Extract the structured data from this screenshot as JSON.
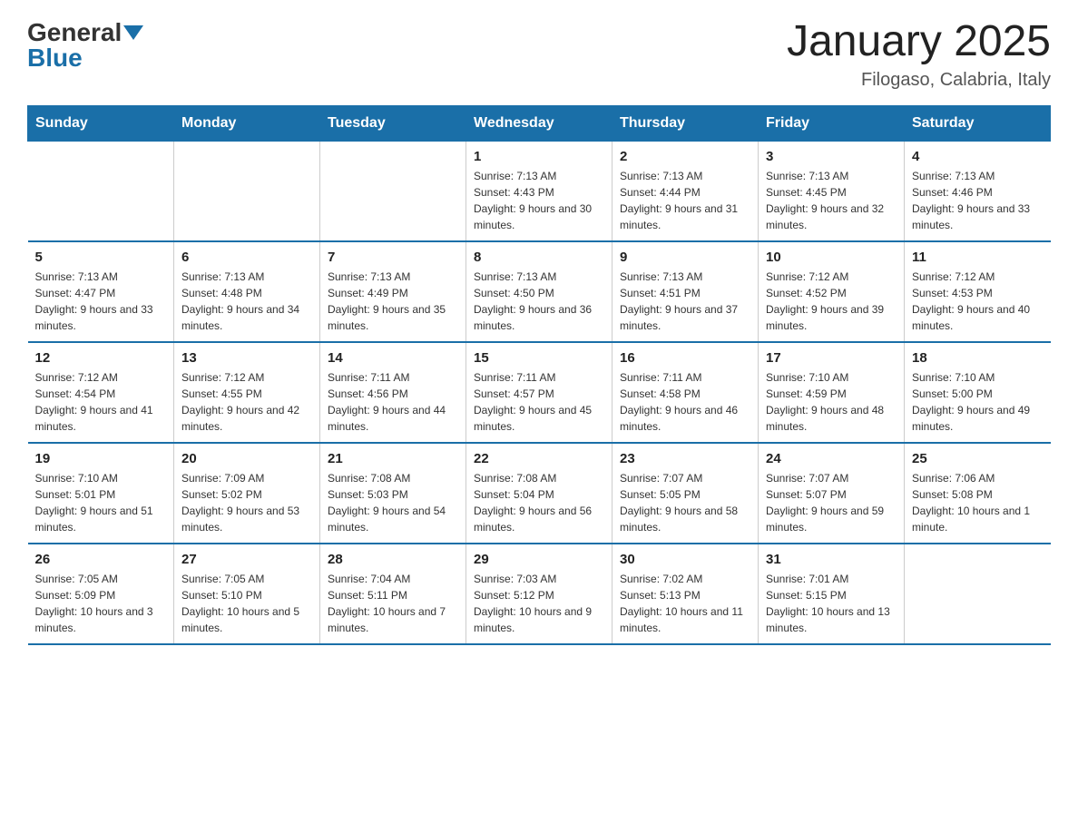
{
  "logo": {
    "general": "General",
    "blue": "Blue"
  },
  "title": "January 2025",
  "subtitle": "Filogaso, Calabria, Italy",
  "days_of_week": [
    "Sunday",
    "Monday",
    "Tuesday",
    "Wednesday",
    "Thursday",
    "Friday",
    "Saturday"
  ],
  "weeks": [
    [
      {
        "day": "",
        "info": ""
      },
      {
        "day": "",
        "info": ""
      },
      {
        "day": "",
        "info": ""
      },
      {
        "day": "1",
        "info": "Sunrise: 7:13 AM\nSunset: 4:43 PM\nDaylight: 9 hours and 30 minutes."
      },
      {
        "day": "2",
        "info": "Sunrise: 7:13 AM\nSunset: 4:44 PM\nDaylight: 9 hours and 31 minutes."
      },
      {
        "day": "3",
        "info": "Sunrise: 7:13 AM\nSunset: 4:45 PM\nDaylight: 9 hours and 32 minutes."
      },
      {
        "day": "4",
        "info": "Sunrise: 7:13 AM\nSunset: 4:46 PM\nDaylight: 9 hours and 33 minutes."
      }
    ],
    [
      {
        "day": "5",
        "info": "Sunrise: 7:13 AM\nSunset: 4:47 PM\nDaylight: 9 hours and 33 minutes."
      },
      {
        "day": "6",
        "info": "Sunrise: 7:13 AM\nSunset: 4:48 PM\nDaylight: 9 hours and 34 minutes."
      },
      {
        "day": "7",
        "info": "Sunrise: 7:13 AM\nSunset: 4:49 PM\nDaylight: 9 hours and 35 minutes."
      },
      {
        "day": "8",
        "info": "Sunrise: 7:13 AM\nSunset: 4:50 PM\nDaylight: 9 hours and 36 minutes."
      },
      {
        "day": "9",
        "info": "Sunrise: 7:13 AM\nSunset: 4:51 PM\nDaylight: 9 hours and 37 minutes."
      },
      {
        "day": "10",
        "info": "Sunrise: 7:12 AM\nSunset: 4:52 PM\nDaylight: 9 hours and 39 minutes."
      },
      {
        "day": "11",
        "info": "Sunrise: 7:12 AM\nSunset: 4:53 PM\nDaylight: 9 hours and 40 minutes."
      }
    ],
    [
      {
        "day": "12",
        "info": "Sunrise: 7:12 AM\nSunset: 4:54 PM\nDaylight: 9 hours and 41 minutes."
      },
      {
        "day": "13",
        "info": "Sunrise: 7:12 AM\nSunset: 4:55 PM\nDaylight: 9 hours and 42 minutes."
      },
      {
        "day": "14",
        "info": "Sunrise: 7:11 AM\nSunset: 4:56 PM\nDaylight: 9 hours and 44 minutes."
      },
      {
        "day": "15",
        "info": "Sunrise: 7:11 AM\nSunset: 4:57 PM\nDaylight: 9 hours and 45 minutes."
      },
      {
        "day": "16",
        "info": "Sunrise: 7:11 AM\nSunset: 4:58 PM\nDaylight: 9 hours and 46 minutes."
      },
      {
        "day": "17",
        "info": "Sunrise: 7:10 AM\nSunset: 4:59 PM\nDaylight: 9 hours and 48 minutes."
      },
      {
        "day": "18",
        "info": "Sunrise: 7:10 AM\nSunset: 5:00 PM\nDaylight: 9 hours and 49 minutes."
      }
    ],
    [
      {
        "day": "19",
        "info": "Sunrise: 7:10 AM\nSunset: 5:01 PM\nDaylight: 9 hours and 51 minutes."
      },
      {
        "day": "20",
        "info": "Sunrise: 7:09 AM\nSunset: 5:02 PM\nDaylight: 9 hours and 53 minutes."
      },
      {
        "day": "21",
        "info": "Sunrise: 7:08 AM\nSunset: 5:03 PM\nDaylight: 9 hours and 54 minutes."
      },
      {
        "day": "22",
        "info": "Sunrise: 7:08 AM\nSunset: 5:04 PM\nDaylight: 9 hours and 56 minutes."
      },
      {
        "day": "23",
        "info": "Sunrise: 7:07 AM\nSunset: 5:05 PM\nDaylight: 9 hours and 58 minutes."
      },
      {
        "day": "24",
        "info": "Sunrise: 7:07 AM\nSunset: 5:07 PM\nDaylight: 9 hours and 59 minutes."
      },
      {
        "day": "25",
        "info": "Sunrise: 7:06 AM\nSunset: 5:08 PM\nDaylight: 10 hours and 1 minute."
      }
    ],
    [
      {
        "day": "26",
        "info": "Sunrise: 7:05 AM\nSunset: 5:09 PM\nDaylight: 10 hours and 3 minutes."
      },
      {
        "day": "27",
        "info": "Sunrise: 7:05 AM\nSunset: 5:10 PM\nDaylight: 10 hours and 5 minutes."
      },
      {
        "day": "28",
        "info": "Sunrise: 7:04 AM\nSunset: 5:11 PM\nDaylight: 10 hours and 7 minutes."
      },
      {
        "day": "29",
        "info": "Sunrise: 7:03 AM\nSunset: 5:12 PM\nDaylight: 10 hours and 9 minutes."
      },
      {
        "day": "30",
        "info": "Sunrise: 7:02 AM\nSunset: 5:13 PM\nDaylight: 10 hours and 11 minutes."
      },
      {
        "day": "31",
        "info": "Sunrise: 7:01 AM\nSunset: 5:15 PM\nDaylight: 10 hours and 13 minutes."
      },
      {
        "day": "",
        "info": ""
      }
    ]
  ]
}
